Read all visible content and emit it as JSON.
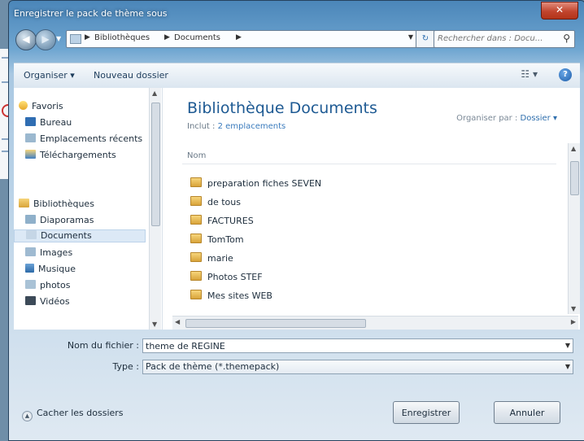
{
  "window": {
    "title": "Enregistrer le pack de thème sous"
  },
  "icons": {
    "close": "close-icon",
    "back": "back-arrow-icon",
    "forward": "forward-arrow-icon",
    "search": "search-icon",
    "help": "help-icon",
    "refresh": "refresh-icon"
  },
  "address": {
    "crumbs": [
      "Bibliothèques",
      "Documents"
    ]
  },
  "search": {
    "placeholder": "Rechercher dans : Docu..."
  },
  "toolbar": {
    "organize": "Organiser ▾",
    "new_folder": "Nouveau dossier"
  },
  "nav": {
    "favorites": "Favoris",
    "bureau": "Bureau",
    "recent": "Emplacements récents",
    "downloads": "Téléchargements",
    "libraries": "Bibliothèques",
    "diaporamas": "Diaporamas",
    "documents": "Documents",
    "images": "Images",
    "musique": "Musique",
    "photos": "photos",
    "videos": "Vidéos"
  },
  "content": {
    "title": "Bibliothèque Documents",
    "includes_label": "Inclut :",
    "includes_value": "2 emplacements",
    "arrange_label": "Organiser par :",
    "arrange_value": "Dossier ▾",
    "column_name": "Nom",
    "files": [
      "preparation fiches SEVEN",
      "de tous",
      "FACTURES",
      "TomTom",
      "marie",
      "Photos STEF",
      "Mes sites WEB"
    ]
  },
  "form": {
    "filename_label": "Nom du fichier :",
    "filename_value": "theme de REGINE",
    "type_label": "Type :",
    "type_value": "Pack de thème (*.themepack)"
  },
  "footer": {
    "hide_folders": "Cacher les dossiers",
    "save": "Enregistrer",
    "cancel": "Annuler"
  }
}
